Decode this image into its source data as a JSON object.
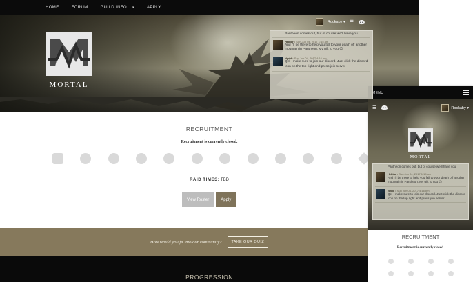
{
  "desktop": {
    "nav": {
      "items": [
        {
          "label": "HOME"
        },
        {
          "label": "FORUM"
        },
        {
          "label": "GUILD INFO"
        },
        {
          "label": "APPLY"
        }
      ],
      "dropdown_caret": "▾"
    },
    "brand": {
      "logo_text": "MORTAL"
    },
    "user": {
      "name": "Rockaby",
      "name_caret": "Rockaby ▾"
    },
    "shoutbox": {
      "partial_top": "Pantheon comes out, but of course we'll have you.",
      "messages": [
        {
          "author": "Hektor",
          "time": "Sun Jun 04, 2017 1:15 am",
          "text": "And I'll be there to help you fall to your death off another mountain in Pantheon. My gift to you 😊"
        },
        {
          "author": "Nydd",
          "time": "Sun Jun 04, 2017 4:16 pm",
          "text": "Qel - make sure to join our discord. Just click the discord icon on the top right and press join server"
        }
      ]
    },
    "recruitment": {
      "title": "RECRUITMENT",
      "status": "Recruitment is currently closed.",
      "raid_label": "RAID TIMES:",
      "raid_value": "TBD",
      "view_roster": "View Roster",
      "apply": "Apply"
    },
    "quiz": {
      "question": "How would you fit into our community?",
      "button": "TAKE OUR QUIZ"
    },
    "progression": {
      "title": "PROGRESSION"
    }
  },
  "mobile": {
    "menu_label": "MENU",
    "user": {
      "name_caret": "Rockaby ▾"
    },
    "brand": {
      "logo_text": "MORTAL"
    },
    "shoutbox": {
      "partial_top": "Pantheon comes out, but of course we'll have you.",
      "messages": [
        {
          "author": "Hektor",
          "time": "Sun Jun 04, 2017 1:15 am",
          "text": "And I'll be there to help you fall to your death off another mountain in Pantheon. My gift to you 😊"
        },
        {
          "author": "Nydd",
          "time": "Sun Jun 04, 2017 4:16 pm",
          "text": "Qel - make sure to join our discord. Just click the discord icon on the top right and press join server"
        }
      ]
    },
    "recruitment": {
      "title": "RECRUITMENT",
      "status": "Recruitment is currently closed."
    }
  },
  "colors": {
    "nav_bg": "#0b0b0b",
    "accent_bronze": "#7f735a",
    "quiz_band": "#86795c",
    "button_gray": "#bdbdbd"
  }
}
